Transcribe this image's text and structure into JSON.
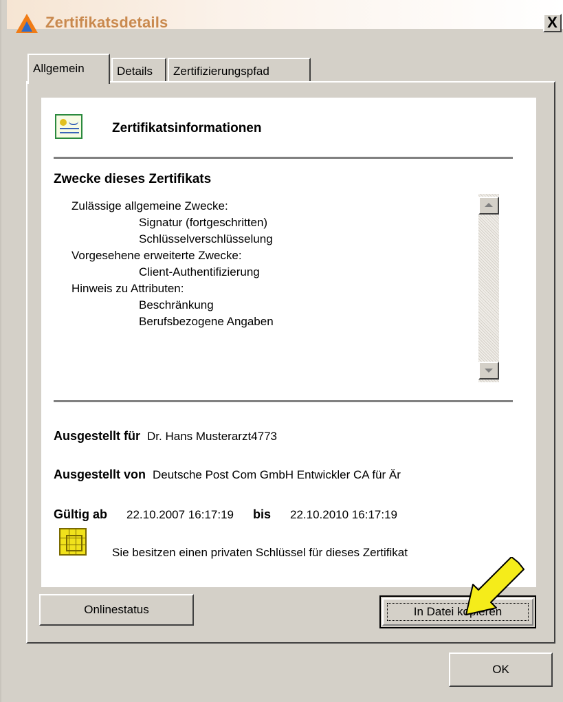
{
  "window": {
    "title": "Zertifikatsdetails",
    "close_label": "X"
  },
  "tabs": [
    {
      "label": "Allgemein",
      "active": true
    },
    {
      "label": "Details",
      "active": false
    },
    {
      "label": "Zertifizierungspfad",
      "active": false
    }
  ],
  "certificate_info": {
    "heading": "Zertifikatsinformationen",
    "purposes_heading": "Zwecke dieses Zertifikats",
    "purposes": [
      {
        "text": "Zulässige allgemeine Zwecke:",
        "level": 1
      },
      {
        "text": "Signatur (fortgeschritten)",
        "level": 2
      },
      {
        "text": "Schlüsselverschlüsselung",
        "level": 2
      },
      {
        "text": "Vorgesehene erweiterte Zwecke:",
        "level": 1
      },
      {
        "text": "Client-Authentifizierung",
        "level": 2
      },
      {
        "text": "Hinweis zu Attributen:",
        "level": 1
      },
      {
        "text": "Beschränkung",
        "level": 2
      },
      {
        "text": "Berufsbezogene Angaben",
        "level": 2
      }
    ],
    "issued_to_label": "Ausgestellt für",
    "issued_to_value": "Dr. Hans Musterarzt4773",
    "issued_by_label": "Ausgestellt von",
    "issued_by_value": "Deutsche Post Com GmbH Entwickler CA für Är",
    "valid_from_label": "Gültig ab",
    "valid_from_value": "22.10.2007 16:17:19",
    "valid_to_label": "bis",
    "valid_to_value": "22.10.2010 16:17:19",
    "private_key_note": "Sie besitzen einen privaten Schlüssel für dieses Zertifikat"
  },
  "buttons": {
    "onlinestatus": "Onlinestatus",
    "copy_to_file": "In Datei kopieren",
    "ok": "OK"
  },
  "colors": {
    "dialog_bg": "#d4d0c8",
    "title_text": "#c9894e",
    "annotation_arrow": "#f5ec1a"
  }
}
